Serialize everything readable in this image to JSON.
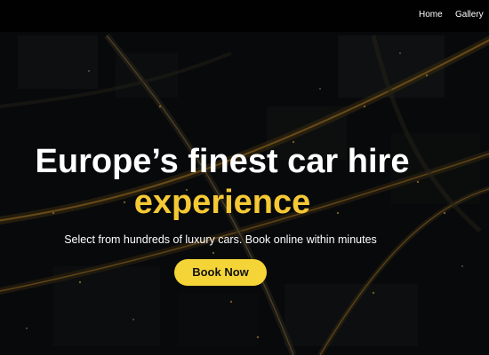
{
  "nav": {
    "links": [
      {
        "label": "Home"
      },
      {
        "label": "Gallery"
      }
    ]
  },
  "hero": {
    "title_line1": "Europe’s finest car hire",
    "title_line2": "experience",
    "subtitle": "Select from hundreds of luxury cars. Book online within minutes",
    "cta_label": "Book Now",
    "background_image": "aerial-night-city-icon"
  },
  "colors": {
    "accent": "#f5c935",
    "button": "#f5d438",
    "nav_background": "#000000",
    "text": "#ffffff"
  }
}
